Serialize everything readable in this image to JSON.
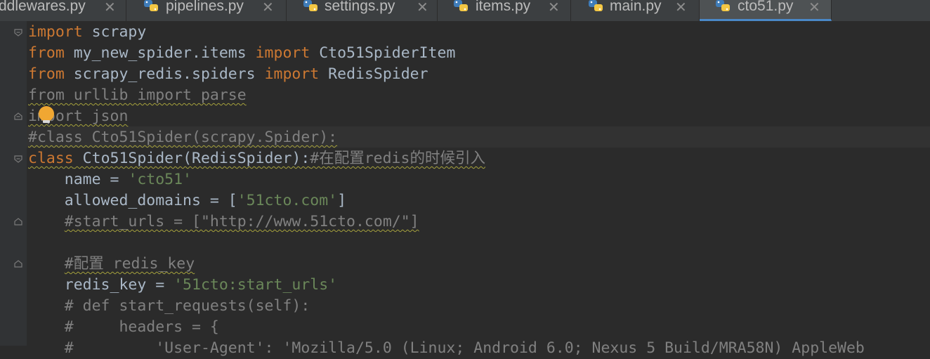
{
  "tabs": [
    {
      "label": "ddlewares.py",
      "active": false
    },
    {
      "label": "pipelines.py",
      "active": false
    },
    {
      "label": "settings.py",
      "active": false
    },
    {
      "label": "items.py",
      "active": false
    },
    {
      "label": "main.py",
      "active": false
    },
    {
      "label": "cto51.py",
      "active": true
    }
  ],
  "tab_close_glyph": "✕",
  "icons": {
    "file_type": "python-file-icon",
    "fold": "fold-marker-icon",
    "intention": "lightbulb-icon"
  },
  "colors": {
    "keyword": "#cc7832",
    "string": "#6a8759",
    "comment": "#808080",
    "text": "#a9b7c6",
    "background": "#2b2b2b",
    "intention_bulb": "#f0a732"
  },
  "code": {
    "l1": {
      "kw": "import",
      "rest": " scrapy"
    },
    "l2": {
      "kw1": "from",
      "mid": " my_new_spider.items ",
      "kw2": "import",
      "rest": " Cto51SpiderItem"
    },
    "l3": {
      "kw1": "from",
      "mid": " scrapy_redis.spiders ",
      "kw2": "import",
      "rest": " RedisSpider"
    },
    "l4": {
      "text": "from urllib import parse"
    },
    "l5": {
      "text": "import json"
    },
    "l6": {
      "text": "#class Cto51Spider(scrapy.Spider):"
    },
    "l7": {
      "kw": "class",
      "name": " Cto51Spider(RedisSpider):",
      "comment": "#在配置redis的时候引入"
    },
    "l8": {
      "pre": "    name = ",
      "str": "'cto51'"
    },
    "l9": {
      "pre": "    allowed_domains = [",
      "str": "'51cto.com'",
      "post": "]"
    },
    "l10": {
      "indent": "    ",
      "text": "#start_urls = [\"http://www.51cto.com/\"]"
    },
    "l11": {
      "text": ""
    },
    "l12": {
      "indent": "    ",
      "text": "#配置 redis_key"
    },
    "l13": {
      "pre": "    redis_key = ",
      "str": "'51cto:start_urls'"
    },
    "l14": {
      "text": "    # def start_requests(self):"
    },
    "l15": {
      "text": "    #     headers = {"
    },
    "l16": {
      "text": "    #         'User-Agent': 'Mozilla/5.0 (Linux; Android 6.0; Nexus 5 Build/MRA58N) AppleWeb"
    }
  }
}
